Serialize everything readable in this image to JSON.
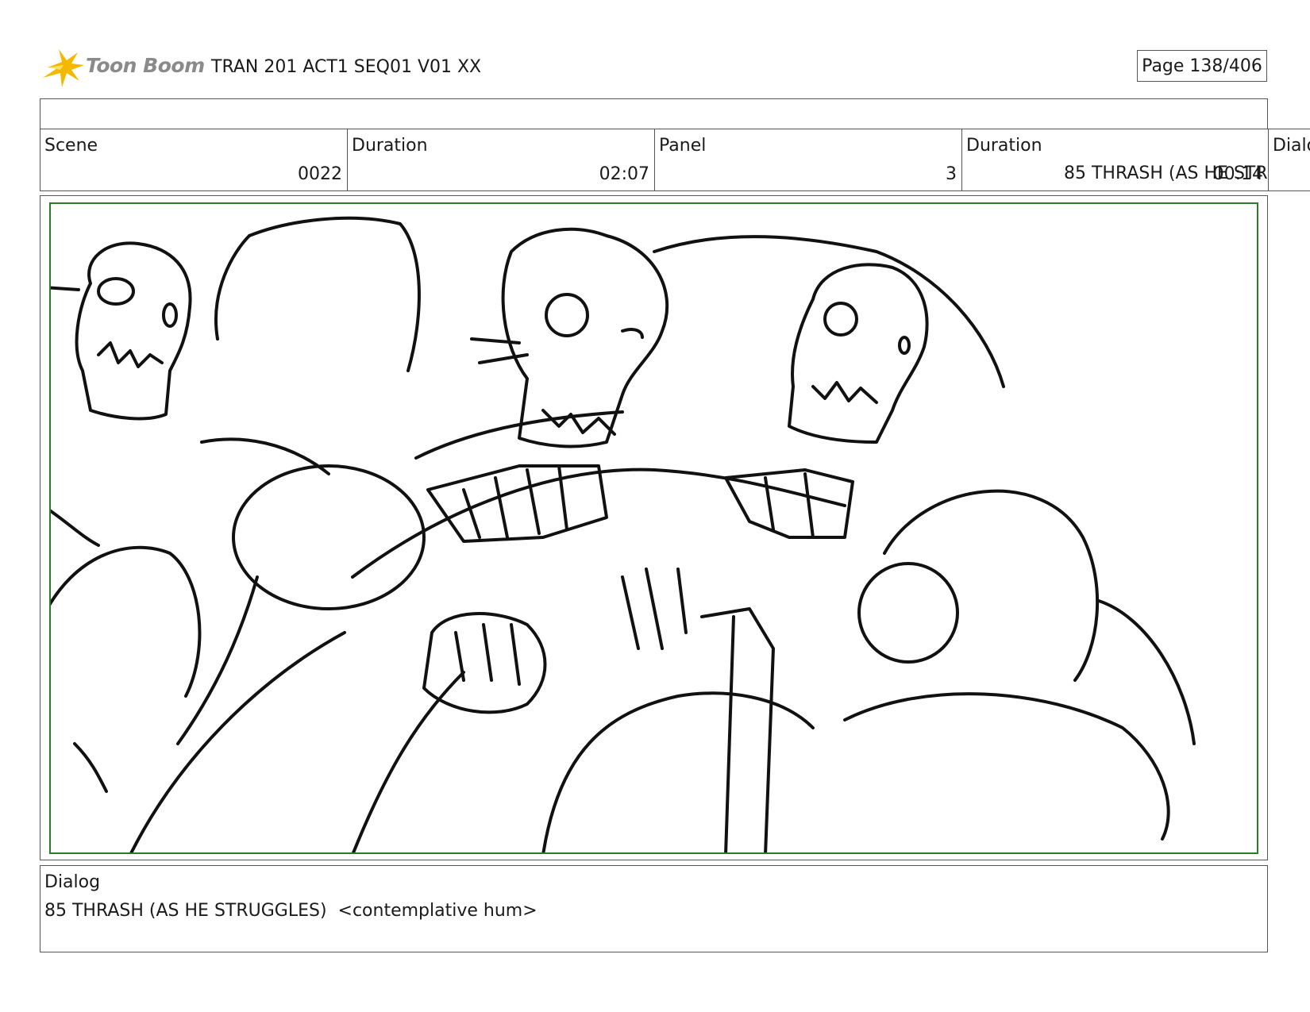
{
  "header": {
    "logo_text": "Toon Boom",
    "doc_title": "TRAN 201 ACT1 SEQ01 V01 XX",
    "page_counter": "Page 138/406",
    "brand_color": "#f5b800"
  },
  "info": {
    "scene_label": "Scene",
    "scene_value": "0022",
    "scene_duration_label": "Duration",
    "scene_duration_value": "02:07",
    "panel_label": "Panel",
    "panel_value": "3",
    "panel_duration_label": "Duration",
    "panel_duration_value": "00:14",
    "overflow_dialog_text": "85 THRASH (AS HE STRUGG",
    "dialog_label_cut": "Dialo"
  },
  "panel": {
    "border_color": "#2d7a2d"
  },
  "dialog": {
    "label": "Dialog",
    "line": "85 THRASH (AS HE STRUGGLES)  <contemplative hum>"
  }
}
